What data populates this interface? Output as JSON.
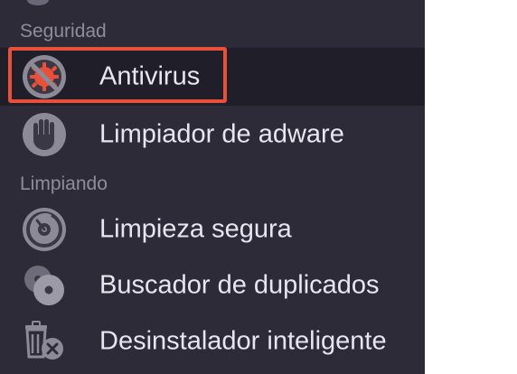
{
  "sidebar": {
    "sections": [
      {
        "header": "Seguridad",
        "items": [
          {
            "label": "Antivirus",
            "icon": "antivirus-icon",
            "selected": true
          },
          {
            "label": "Limpiador de adware",
            "icon": "hand-stop-icon",
            "selected": false
          }
        ]
      },
      {
        "header": "Limpiando",
        "items": [
          {
            "label": "Limpieza segura",
            "icon": "secure-wipe-icon",
            "selected": false
          },
          {
            "label": "Buscador de duplicados",
            "icon": "duplicates-icon",
            "selected": false
          },
          {
            "label": "Desinstalador inteligente",
            "icon": "trash-uninstall-icon",
            "selected": false
          }
        ]
      }
    ]
  },
  "colors": {
    "sidebar_bg": "#2d2b38",
    "selected_bg": "#1f1e29",
    "highlight_border": "#e8503a",
    "label_text": "#e7e5ee",
    "header_text": "#8f8c9c",
    "accent_red": "#e8503a"
  }
}
